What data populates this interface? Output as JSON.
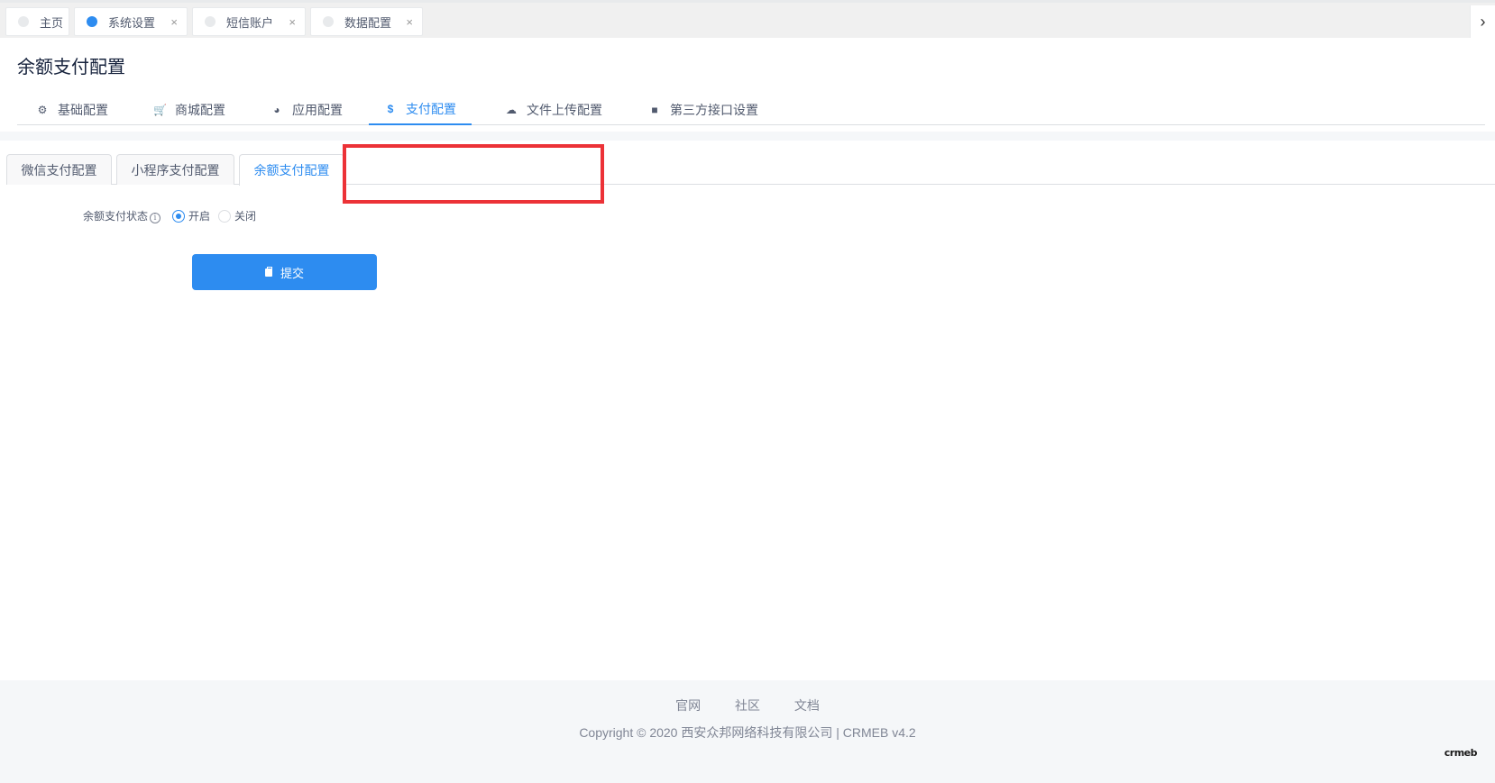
{
  "tabbar": {
    "tags": [
      {
        "label": "主页",
        "closable": false,
        "active": false
      },
      {
        "label": "系统设置",
        "closable": true,
        "active": true
      },
      {
        "label": "短信账户",
        "closable": true,
        "active": false
      },
      {
        "label": "数据配置",
        "closable": true,
        "active": false
      }
    ],
    "close_glyph": "×",
    "next_glyph": "›"
  },
  "page": {
    "title": "余额支付配置"
  },
  "main_tabs": [
    {
      "label": "基础配置",
      "icon": "gear-icon",
      "glyph": "⚙",
      "active": false
    },
    {
      "label": "商城配置",
      "icon": "cart-icon",
      "glyph": "🛒",
      "active": false
    },
    {
      "label": "应用配置",
      "icon": "pie-chart-icon",
      "glyph": "◕",
      "active": false
    },
    {
      "label": "支付配置",
      "icon": "dollar-icon",
      "glyph": "$",
      "active": true
    },
    {
      "label": "文件上传配置",
      "icon": "cloud-upload-icon",
      "glyph": "☁",
      "active": false
    },
    {
      "label": "第三方接口设置",
      "icon": "briefcase-icon",
      "glyph": "■",
      "active": false
    }
  ],
  "sub_tabs": [
    {
      "label": "微信支付配置",
      "active": false
    },
    {
      "label": "小程序支付配置",
      "active": false
    },
    {
      "label": "余额支付配置",
      "active": true
    }
  ],
  "form": {
    "status_label": "余额支付状态",
    "info_glyph": "i",
    "options": [
      {
        "label": "开启",
        "checked": true
      },
      {
        "label": "关闭",
        "checked": false
      }
    ],
    "submit_label": "提交"
  },
  "footer": {
    "links": [
      "官网",
      "社区",
      "文档"
    ],
    "copyright": "Copyright © 2020 西安众邦网络科技有限公司 | CRMEB v4.2",
    "logo_text": "crmeb"
  },
  "colors": {
    "primary": "#2d8cf0",
    "annotation_red": "#ec3237"
  }
}
